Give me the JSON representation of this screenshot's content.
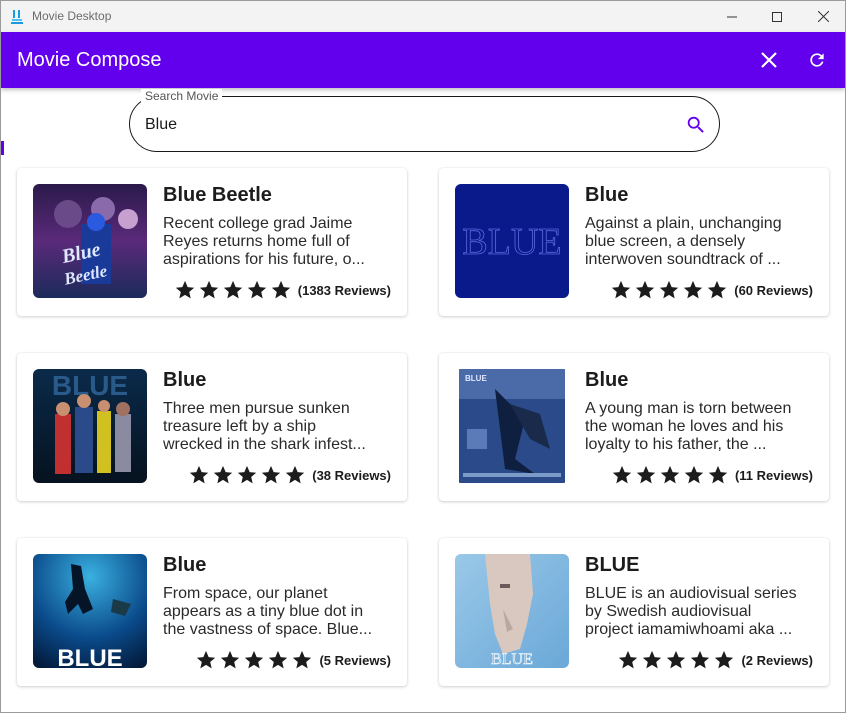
{
  "window": {
    "title": "Movie Desktop"
  },
  "appbar": {
    "title": "Movie Compose",
    "close_icon": "close-icon",
    "refresh_icon": "refresh-icon",
    "color": "#6200ee"
  },
  "search": {
    "label": "Search Movie",
    "value": "Blue",
    "icon": "search-icon",
    "icon_color": "#6200ee"
  },
  "movies": [
    {
      "title": "Blue Beetle",
      "desc_lines": [
        "Recent college grad Jaime",
        "Reyes returns home full of",
        "aspirations for his future, o..."
      ],
      "rating": 5,
      "reviews": "(1383 Reviews)"
    },
    {
      "title": "Blue",
      "desc_lines": [
        "Against a plain, unchanging",
        "blue screen, a densely",
        "interwoven soundtrack of ..."
      ],
      "rating": 5,
      "reviews": "(60 Reviews)"
    },
    {
      "title": "Blue",
      "desc_lines": [
        "Three men pursue sunken",
        "treasure left by a ship",
        "wrecked in the shark infest..."
      ],
      "rating": 5,
      "reviews": "(38 Reviews)"
    },
    {
      "title": "Blue",
      "desc_lines": [
        "A young man is torn between",
        "the woman he loves and his",
        "loyalty to his father, the ..."
      ],
      "rating": 5,
      "reviews": "(11 Reviews)"
    },
    {
      "title": "Blue",
      "desc_lines": [
        "From space, our planet",
        "appears as a tiny blue dot in",
        "the vastness of space. Blue..."
      ],
      "rating": 5,
      "reviews": "(5 Reviews)"
    },
    {
      "title": "BLUE",
      "desc_lines": [
        "BLUE is an audiovisual series",
        "by Swedish audiovisual",
        "project iamamiwhoami aka ..."
      ],
      "rating": 5,
      "reviews": "(2 Reviews)"
    }
  ],
  "posters": {
    "p0": {
      "text": "Blue Beetle"
    },
    "p1": {
      "text": "BLUE"
    },
    "p2": {
      "text": "BLUE"
    },
    "p3": {
      "text": "BLUE"
    },
    "p4": {
      "text": "BLUE"
    },
    "p5": {
      "text": "BLUE"
    }
  }
}
